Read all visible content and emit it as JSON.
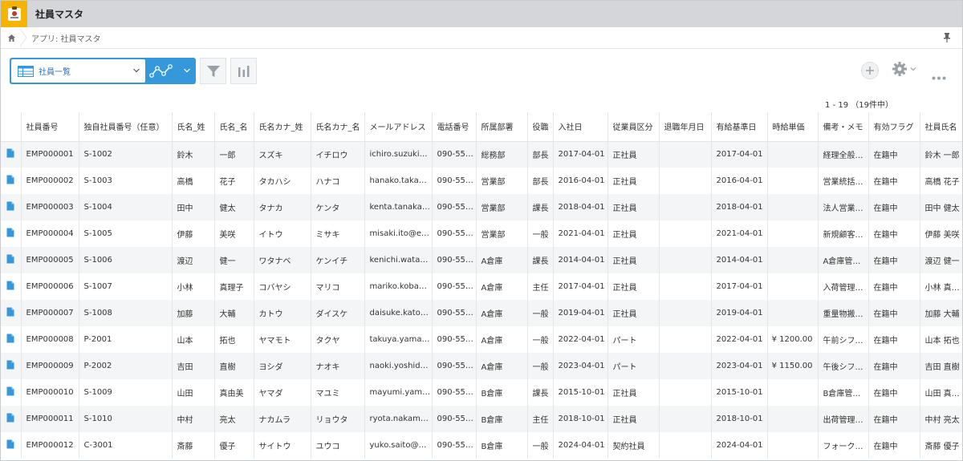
{
  "app": {
    "title": "社員マスタ"
  },
  "breadcrumb": {
    "text": "アプリ: 社員マスタ"
  },
  "toolbar": {
    "view_label": "社員一覧"
  },
  "pager": {
    "text": "1 - 19 （19件中）"
  },
  "table": {
    "columns": [
      "社員番号",
      "独自社員番号（任意）",
      "氏名_姓",
      "氏名_名",
      "氏名カナ_姓",
      "氏名カナ_名",
      "メールアドレス",
      "電話番号",
      "所属部署",
      "役職",
      "入社日",
      "従業員区分",
      "退職年月日",
      "有給基準日",
      "時給単価",
      "備考・メモ",
      "有効フラグ",
      "社員氏名"
    ],
    "rows": [
      [
        "EMP000001",
        "S-1002",
        "鈴木",
        "一郎",
        "スズキ",
        "イチロウ",
        "ichiro.suzuki…",
        "090-55…",
        "総務部",
        "部長",
        "2017-04-01",
        "正社員",
        "",
        "2017-04-01",
        "",
        "経理全般…",
        "在籍中",
        "鈴木 一郎"
      ],
      [
        "EMP000002",
        "S-1003",
        "高橋",
        "花子",
        "タカハシ",
        "ハナコ",
        "hanako.takah…",
        "090-55…",
        "営業部",
        "部長",
        "2016-04-01",
        "正社員",
        "",
        "2016-04-01",
        "",
        "営業統括…",
        "在籍中",
        "高橋 花子"
      ],
      [
        "EMP000003",
        "S-1004",
        "田中",
        "健太",
        "タナカ",
        "ケンタ",
        "kenta.tanaka…",
        "090-55…",
        "営業部",
        "課長",
        "2018-04-01",
        "正社員",
        "",
        "2018-04-01",
        "",
        "法人営業…",
        "在籍中",
        "田中 健太"
      ],
      [
        "EMP000004",
        "S-1005",
        "伊藤",
        "美咲",
        "イトウ",
        "ミサキ",
        "misaki.ito@ex…",
        "090-55…",
        "営業部",
        "一般",
        "2021-04-01",
        "正社員",
        "",
        "2021-04-01",
        "",
        "新規顧客…",
        "在籍中",
        "伊藤 美咲"
      ],
      [
        "EMP000005",
        "S-1006",
        "渡辺",
        "健一",
        "ワタナベ",
        "ケンイチ",
        "kenichi.watan…",
        "090-55…",
        "A倉庫",
        "課長",
        "2014-04-01",
        "正社員",
        "",
        "2014-04-01",
        "",
        "A倉庫管理…",
        "在籍中",
        "渡辺 健一"
      ],
      [
        "EMP000006",
        "S-1007",
        "小林",
        "真理子",
        "コバヤシ",
        "マリコ",
        "mariko.kobay…",
        "090-55…",
        "A倉庫",
        "主任",
        "2017-04-01",
        "正社員",
        "",
        "2017-04-01",
        "",
        "入荷管理…",
        "在籍中",
        "小林 真…"
      ],
      [
        "EMP000007",
        "S-1008",
        "加藤",
        "大輔",
        "カトウ",
        "ダイスケ",
        "daisuke.kato…",
        "090-55…",
        "A倉庫",
        "一般",
        "2019-04-01",
        "正社員",
        "",
        "2019-04-01",
        "",
        "重量物搬…",
        "在籍中",
        "加藤 大輔"
      ],
      [
        "EMP000008",
        "P-2001",
        "山本",
        "拓也",
        "ヤマモト",
        "タクヤ",
        "takuya.yama…",
        "090-55…",
        "A倉庫",
        "一般",
        "2022-04-01",
        "パート",
        "",
        "2022-04-01",
        "¥ 1200.00",
        "午前シフ…",
        "在籍中",
        "山本 拓也"
      ],
      [
        "EMP000009",
        "P-2002",
        "吉田",
        "直樹",
        "ヨシダ",
        "ナオキ",
        "naoki.yoshida…",
        "090-55…",
        "A倉庫",
        "一般",
        "2023-04-01",
        "パート",
        "",
        "2023-04-01",
        "¥ 1150.00",
        "午後シフ…",
        "在籍中",
        "吉田 直樹"
      ],
      [
        "EMP000010",
        "S-1009",
        "山田",
        "真由美",
        "ヤマダ",
        "マユミ",
        "mayumi.yam…",
        "090-55…",
        "B倉庫",
        "課長",
        "2015-10-01",
        "正社員",
        "",
        "2015-10-01",
        "",
        "B倉庫管理…",
        "在籍中",
        "山田 真…"
      ],
      [
        "EMP000011",
        "S-1010",
        "中村",
        "亮太",
        "ナカムラ",
        "リョウタ",
        "ryota.nakamu…",
        "090-55…",
        "B倉庫",
        "主任",
        "2018-10-01",
        "正社員",
        "",
        "2018-10-01",
        "",
        "出荷管理…",
        "在籍中",
        "中村 亮太"
      ],
      [
        "EMP000012",
        "C-3001",
        "斎藤",
        "優子",
        "サイトウ",
        "ユウコ",
        "yuko.saito@e…",
        "090-55…",
        "B倉庫",
        "一般",
        "2024-04-01",
        "契約社員",
        "",
        "2024-04-01",
        "",
        "フォーク…",
        "在籍中",
        "斎藤 優子"
      ]
    ]
  },
  "colors": {
    "accent": "#3498db",
    "app_icon": "#f5b400",
    "header_bg": "#d4d6d9"
  }
}
